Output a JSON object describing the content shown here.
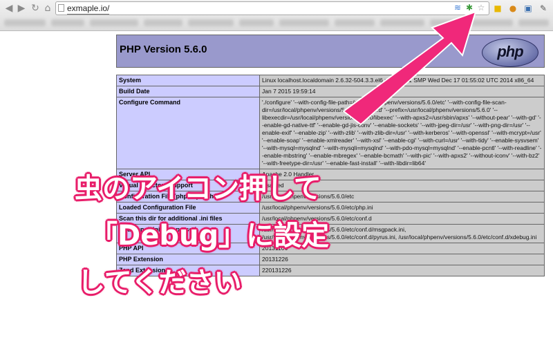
{
  "browser": {
    "url": "exmaple.io/",
    "colors": {
      "chrome": "#e6e6e6"
    }
  },
  "php": {
    "version_title": "PHP Version 5.6.0",
    "logo_text": "php",
    "header_color": "#9999cc",
    "label_color": "#ccccff",
    "value_color": "#cccccc",
    "rows": [
      {
        "k": "System",
        "v": "Linux localhost.localdomain 2.6.32-504.3.3.el6.x86_64 #1 SMP Wed Dec 17 01:55:02 UTC 2014 x86_64"
      },
      {
        "k": "Build Date",
        "v": "Jan 7 2015 19:59:14"
      },
      {
        "k": "Configure Command",
        "v": "'./configure' '--with-config-file-path=/usr/local/phpenv/versions/5.6.0/etc' '--with-config-file-scan-dir=/usr/local/phpenv/versions/5.6.0/etc/conf.d' '--prefix=/usr/local/phpenv/versions/5.6.0' '--libexecdir=/usr/local/phpenv/versions/5.6.0/libexec' '--with-apxs2=/usr/sbin/apxs' '--without-pear' '--with-gd' '--enable-gd-native-ttf' '--enable-gd-jis-conv' '--enable-sockets' '--with-jpeg-dir=/usr' '--with-png-dir=/usr' '--enable-exif' '--enable-zip' '--with-zlib' '--with-zlib-dir=/usr' '--with-kerberos' '--with-openssl' '--with-mcrypt=/usr' '--enable-soap' '--enable-xmlreader' '--with-xsl' '--enable-cgi' '--with-curl=/usr' '--with-tidy' '--enable-sysvsem' '--with-mysql=mysqlnd' '--with-mysqli=mysqlnd' '--with-pdo-mysql=mysqlnd' '--enable-pcntl' '--with-readline' '--enable-mbstring' '--enable-mbregex' '--enable-bcmath' '--with-pic' '--with-apxs2' '--without-iconv' '--with-bz2' '--with-freetype-dir=/usr' '--enable-fast-install' '--with-libdir=lib64'"
      },
      {
        "k": "Server API",
        "v": "Apache 2.0 Handler"
      },
      {
        "k": "Virtual Directory Support",
        "v": "disabled"
      },
      {
        "k": "Configuration File (php.ini) Path",
        "v": "/usr/local/phpenv/versions/5.6.0/etc"
      },
      {
        "k": "Loaded Configuration File",
        "v": "/usr/local/phpenv/versions/5.6.0/etc/php.ini"
      },
      {
        "k": "Scan this dir for additional .ini files",
        "v": "/usr/local/phpenv/versions/5.6.0/etc/conf.d"
      },
      {
        "k": "Additional .ini files parsed",
        "v": "/usr/local/phpenv/versions/5.6.0/etc/conf.d/msgpack.ini, /usr/local/phpenv/versions/5.6.0/etc/conf.d/pyrus.ini, /usr/local/phpenv/versions/5.6.0/etc/conf.d/xdebug.ini"
      },
      {
        "k": "PHP API",
        "v": "20131106"
      },
      {
        "k": "PHP Extension",
        "v": "20131226"
      },
      {
        "k": "Zend Extension",
        "v": "220131226"
      }
    ]
  },
  "annotation": {
    "line1": "虫のアイコン押して",
    "line2": "「Debug」に設定",
    "line3": "してください",
    "color": "#e81e6a"
  }
}
